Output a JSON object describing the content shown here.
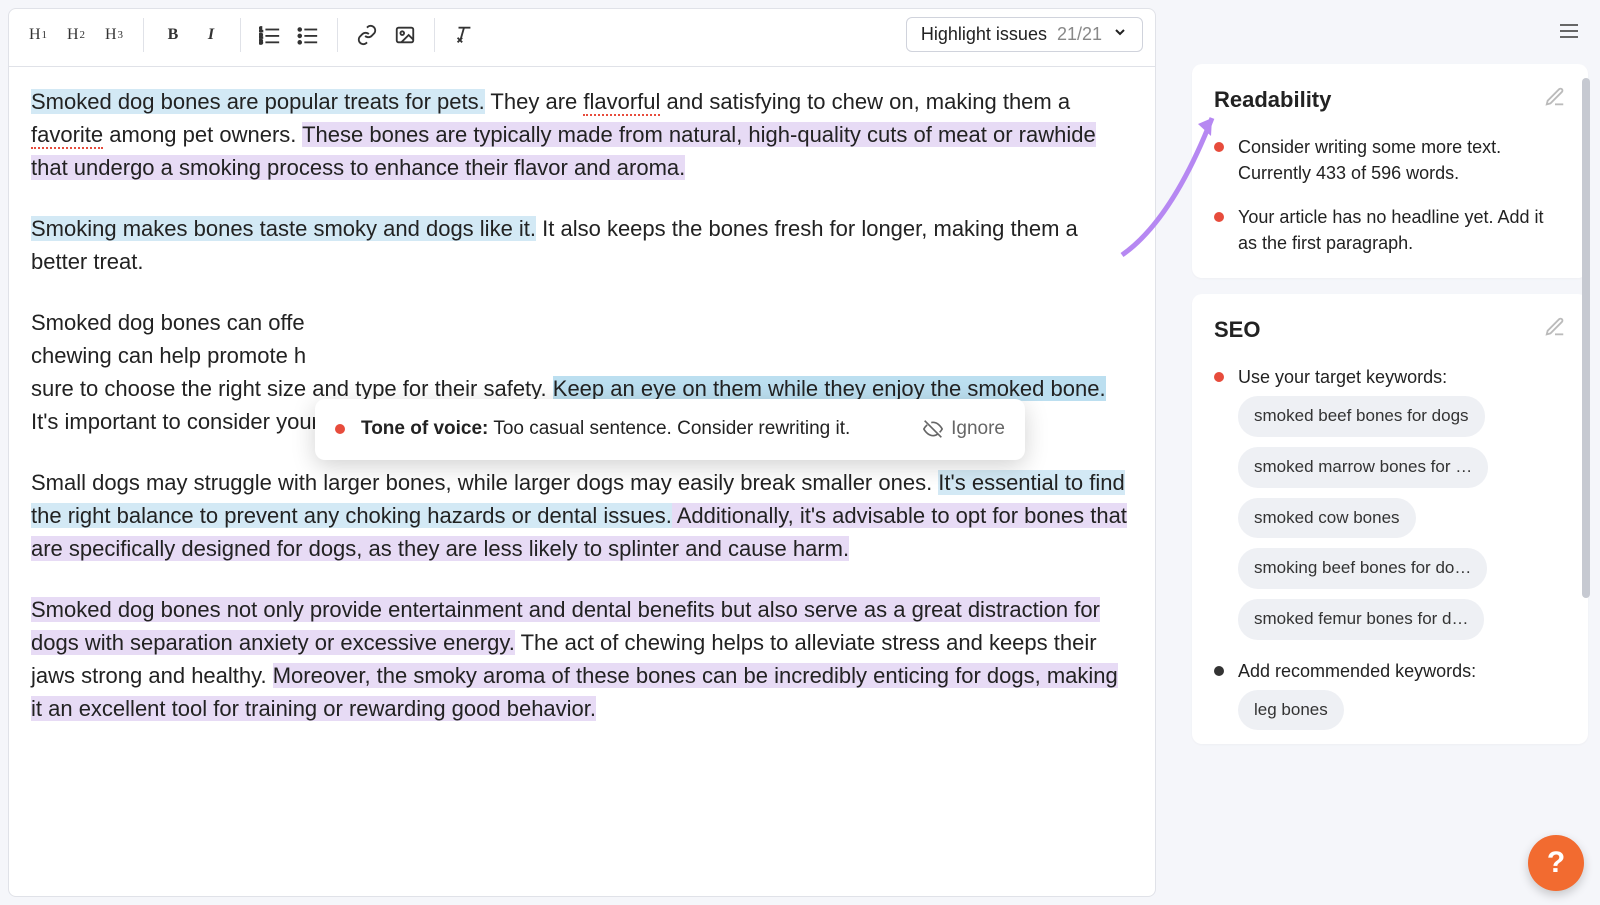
{
  "toolbar": {
    "h1": "H",
    "h2": "H",
    "h3": "H"
  },
  "highlight_dropdown": {
    "label": "Highlight issues",
    "count": "21/21"
  },
  "tooltip": {
    "title": "Tone of voice:",
    "message": "Too casual sentence. Consider rewriting it.",
    "ignore": "Ignore"
  },
  "paragraphs": {
    "p1": {
      "s1": "Smoked dog bones are popular treats for pets.",
      "s2a": " They are ",
      "s2_typo": "flavorful",
      "s2b": " and satisfying to chew on, making them a ",
      "s2_typo2": "favorite",
      "s2c": " among pet owners. ",
      "s3": "These bones are typically made from natural, high-quality cuts of meat or rawhide that undergo a smoking process to enhance their flavor and aroma."
    },
    "p2": {
      "s1": "Smoking makes bones taste smoky and dogs like it.",
      "s2": " It also keeps the bones fresh for longer, making them a better treat."
    },
    "p3": {
      "s1a": "Smoked dog bones can offe",
      "s1b": "chewing can help promote h",
      "s1c": "sure to choose the right size and type for their safety. ",
      "s2": "Keep an eye on them while they enjoy the smoked bone.",
      "s3": " It's important to consider your dog's size and breed when selecting smoked bones."
    },
    "p4": {
      "s1": "Small dogs may struggle with larger bones, while larger dogs may easily break smaller ones. ",
      "s2": "It's essential to find the right balance to prevent any choking hazards or dental issues.",
      "s3": " Additionally, it's advisable to opt for bones that are specifically designed for dogs, as they are less likely to splinter and cause harm."
    },
    "p5": {
      "s1": "Smoked dog bones not only provide entertainment and dental benefits but also serve as a great distraction for dogs with separation anxiety or excessive energy.",
      "s2": " The act of chewing helps to alleviate stress and keeps their jaws strong and healthy. ",
      "s3": "Moreover, the smoky aroma of these bones can be incredibly enticing for dogs, making it an excellent tool for training or rewarding good behavior."
    }
  },
  "sidebar": {
    "readability": {
      "title": "Readability",
      "items": [
        "Consider writing some more text. Currently 433 of 596 words.",
        "Your article has no headline yet. Add it as the first paragraph."
      ]
    },
    "seo": {
      "title": "SEO",
      "item1": "Use your target keywords:",
      "keywords": [
        "smoked beef bones for dogs",
        "smoked marrow bones for …",
        "smoked cow bones",
        "smoking beef bones for do…",
        "smoked femur bones for d…"
      ],
      "item2": "Add recommended keywords:",
      "rec_keywords": [
        "leg bones"
      ]
    }
  },
  "help": "?"
}
